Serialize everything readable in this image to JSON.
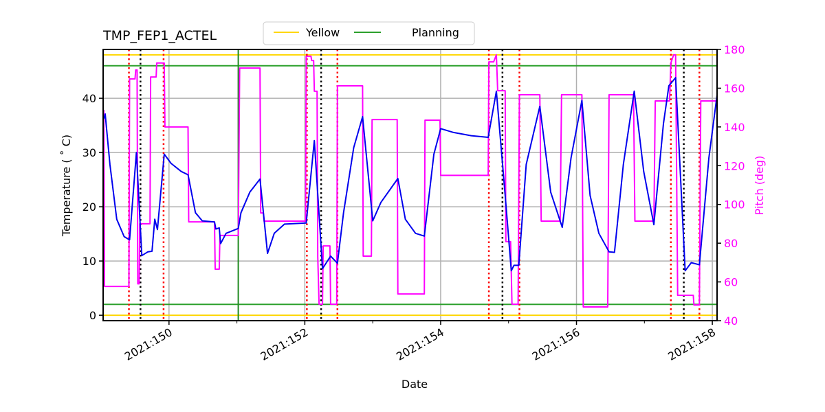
{
  "chart_data": {
    "type": "line",
    "title": "TMP_FEP1_ACTEL",
    "xlabel": "Date",
    "ylabel": "Temperature ($^\\circ$C)",
    "ylabel_display": "Temperature ( ˚ C)",
    "y2label": "Pitch (deg)",
    "xlim": [
      149.03,
      158.07
    ],
    "ylim": [
      -1,
      49
    ],
    "y2lim": [
      40,
      180
    ],
    "grid": true,
    "legend_placement": "top-center",
    "x_ticks": [
      {
        "value": 150,
        "label": "2021:150"
      },
      {
        "value": 152,
        "label": "2021:152"
      },
      {
        "value": 154,
        "label": "2021:154"
      },
      {
        "value": 156,
        "label": "2021:156"
      },
      {
        "value": 158,
        "label": "2021:158"
      }
    ],
    "x_minor_ticks": [
      151,
      153,
      155,
      157
    ],
    "y_ticks": [
      0,
      10,
      20,
      30,
      40
    ],
    "y2_ticks": [
      40,
      60,
      80,
      100,
      120,
      140,
      160,
      180
    ],
    "colors": {
      "temperature": "#0000ee",
      "pitch": "#ff00ff",
      "yellow_limit": "#ffd700",
      "planning_limit": "#2ca02c",
      "planning_vline": "#228b22",
      "red_marker": "#ff0000",
      "black_marker": "#000000",
      "grid": "#b0b0b0"
    },
    "legend": [
      {
        "label": "Yellow",
        "color": "#ffd700"
      },
      {
        "label": "Planning",
        "color": "#2ca02c"
      }
    ],
    "limit_lines": [
      {
        "name": "yellow-high",
        "value": 48,
        "legend": "Yellow"
      },
      {
        "name": "planning-high",
        "value": 46,
        "legend": "Planning"
      },
      {
        "name": "planning-low",
        "value": 2,
        "legend": "Planning"
      },
      {
        "name": "yellow-low",
        "value": 0,
        "legend": "Yellow"
      }
    ],
    "vertical_markers": {
      "red_dotted": [
        149.41,
        149.92,
        152.03,
        152.48,
        154.71,
        155.16,
        157.39,
        157.81
      ],
      "black_dotted": [
        149.58,
        152.24,
        154.91,
        157.58
      ],
      "green_solid": [
        151.02
      ]
    },
    "series": [
      {
        "name": "Temperature",
        "axis": "left",
        "points": [
          [
            149.04,
            36.2
          ],
          [
            149.06,
            37.1
          ],
          [
            149.13,
            27.8
          ],
          [
            149.23,
            17.7
          ],
          [
            149.34,
            14.5
          ],
          [
            149.42,
            13.9
          ],
          [
            149.52,
            30.0
          ],
          [
            149.6,
            11.0
          ],
          [
            149.69,
            11.7
          ],
          [
            149.75,
            11.8
          ],
          [
            149.79,
            17.7
          ],
          [
            149.83,
            15.8
          ],
          [
            149.93,
            29.7
          ],
          [
            150.03,
            28.0
          ],
          [
            150.18,
            26.5
          ],
          [
            150.28,
            25.9
          ],
          [
            150.39,
            18.9
          ],
          [
            150.49,
            17.4
          ],
          [
            150.67,
            17.2
          ],
          [
            150.69,
            15.9
          ],
          [
            150.74,
            16.1
          ],
          [
            150.76,
            13.2
          ],
          [
            150.84,
            15.1
          ],
          [
            151.02,
            16.0
          ],
          [
            151.06,
            18.9
          ],
          [
            151.19,
            22.7
          ],
          [
            151.34,
            25.1
          ],
          [
            151.45,
            11.4
          ],
          [
            151.55,
            15.1
          ],
          [
            151.7,
            16.8
          ],
          [
            152.02,
            17.0
          ],
          [
            152.14,
            32.2
          ],
          [
            152.26,
            8.6
          ],
          [
            152.38,
            10.9
          ],
          [
            152.48,
            9.6
          ],
          [
            152.57,
            18.9
          ],
          [
            152.72,
            30.9
          ],
          [
            152.85,
            36.6
          ],
          [
            153.0,
            17.4
          ],
          [
            153.12,
            20.8
          ],
          [
            153.37,
            25.2
          ],
          [
            153.48,
            17.7
          ],
          [
            153.63,
            15.1
          ],
          [
            153.76,
            14.6
          ],
          [
            153.9,
            29.7
          ],
          [
            154.0,
            34.4
          ],
          [
            154.19,
            33.7
          ],
          [
            154.45,
            33.1
          ],
          [
            154.7,
            32.8
          ],
          [
            154.82,
            41.3
          ],
          [
            154.95,
            22.1
          ],
          [
            155.04,
            8.2
          ],
          [
            155.08,
            9.2
          ],
          [
            155.15,
            9.2
          ],
          [
            155.26,
            27.8
          ],
          [
            155.46,
            38.5
          ],
          [
            155.62,
            22.7
          ],
          [
            155.79,
            16.2
          ],
          [
            155.92,
            29.0
          ],
          [
            156.08,
            39.6
          ],
          [
            156.2,
            22.1
          ],
          [
            156.33,
            15.1
          ],
          [
            156.48,
            11.7
          ],
          [
            156.56,
            11.6
          ],
          [
            156.69,
            27.8
          ],
          [
            156.85,
            41.3
          ],
          [
            156.99,
            26.5
          ],
          [
            157.14,
            16.7
          ],
          [
            157.28,
            35.3
          ],
          [
            157.36,
            42.3
          ],
          [
            157.46,
            43.8
          ],
          [
            157.6,
            8.2
          ],
          [
            157.69,
            9.7
          ],
          [
            157.81,
            9.3
          ],
          [
            157.95,
            29.0
          ],
          [
            158.07,
            40.6
          ]
        ]
      },
      {
        "name": "Pitch",
        "axis": "right",
        "points": [
          [
            149.04,
            148.8
          ],
          [
            149.05,
            57.7
          ],
          [
            149.41,
            57.7
          ],
          [
            149.42,
            164.8
          ],
          [
            149.5,
            164.8
          ],
          [
            149.51,
            169.4
          ],
          [
            149.53,
            169.4
          ],
          [
            149.54,
            59.0
          ],
          [
            149.56,
            59.0
          ],
          [
            149.57,
            90.0
          ],
          [
            149.72,
            90.0
          ],
          [
            149.73,
            165.8
          ],
          [
            149.81,
            165.8
          ],
          [
            149.82,
            173.0
          ],
          [
            149.93,
            173.0
          ],
          [
            149.94,
            140.0
          ],
          [
            150.28,
            140.0
          ],
          [
            150.29,
            91.0
          ],
          [
            150.67,
            91.0
          ],
          [
            150.68,
            66.6
          ],
          [
            150.74,
            66.6
          ],
          [
            150.75,
            84.0
          ],
          [
            151.02,
            84.0
          ],
          [
            151.04,
            170.4
          ],
          [
            151.34,
            170.4
          ],
          [
            151.35,
            95.6
          ],
          [
            151.39,
            95.6
          ],
          [
            151.4,
            91.4
          ],
          [
            152.01,
            91.4
          ],
          [
            152.02,
            176.5
          ],
          [
            152.09,
            176.5
          ],
          [
            152.1,
            174.3
          ],
          [
            152.13,
            174.3
          ],
          [
            152.14,
            158.4
          ],
          [
            152.18,
            158.4
          ],
          [
            152.19,
            73.0
          ],
          [
            152.21,
            48.5
          ],
          [
            152.26,
            48.5
          ],
          [
            152.27,
            78.6
          ],
          [
            152.37,
            78.6
          ],
          [
            152.38,
            48.5
          ],
          [
            152.47,
            48.5
          ],
          [
            152.48,
            161.2
          ],
          [
            152.85,
            161.2
          ],
          [
            152.86,
            73.3
          ],
          [
            152.98,
            73.3
          ],
          [
            152.99,
            143.8
          ],
          [
            153.36,
            143.8
          ],
          [
            153.37,
            53.8
          ],
          [
            153.76,
            53.8
          ],
          [
            153.77,
            143.5
          ],
          [
            153.99,
            143.5
          ],
          [
            154.0,
            115.0
          ],
          [
            154.7,
            115.0
          ],
          [
            154.71,
            173.6
          ],
          [
            154.78,
            173.6
          ],
          [
            154.82,
            177.2
          ],
          [
            154.84,
            158.7
          ],
          [
            154.95,
            158.7
          ],
          [
            154.96,
            80.8
          ],
          [
            155.03,
            80.8
          ],
          [
            155.05,
            48.5
          ],
          [
            155.14,
            48.5
          ],
          [
            155.16,
            156.6
          ],
          [
            155.46,
            156.6
          ],
          [
            155.48,
            91.4
          ],
          [
            155.76,
            91.4
          ],
          [
            155.78,
            156.6
          ],
          [
            156.08,
            156.6
          ],
          [
            156.1,
            47.1
          ],
          [
            156.46,
            47.1
          ],
          [
            156.48,
            156.6
          ],
          [
            156.84,
            156.6
          ],
          [
            156.86,
            91.4
          ],
          [
            157.14,
            91.4
          ],
          [
            157.16,
            153.4
          ],
          [
            157.37,
            153.4
          ],
          [
            157.39,
            173.0
          ],
          [
            157.43,
            177.2
          ],
          [
            157.46,
            177.2
          ],
          [
            157.49,
            53.1
          ],
          [
            157.72,
            53.1
          ],
          [
            157.73,
            48.1
          ],
          [
            157.81,
            48.1
          ],
          [
            157.83,
            153.4
          ],
          [
            158.07,
            153.4
          ]
        ]
      }
    ]
  }
}
